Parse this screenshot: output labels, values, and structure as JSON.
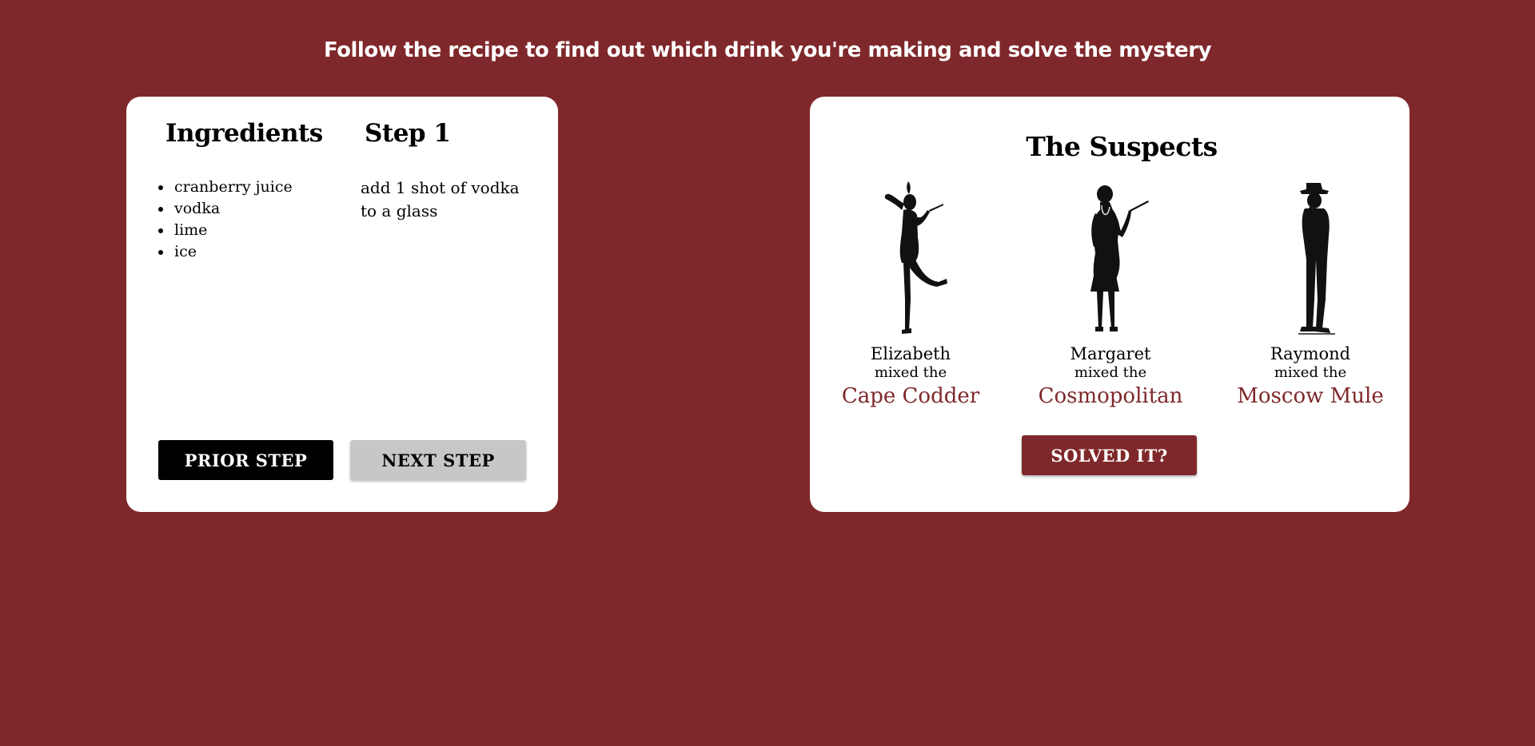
{
  "header": {
    "headline": "Follow the recipe to find out which drink you're making and solve the mystery"
  },
  "recipe": {
    "ingredients_title": "Ingredients",
    "ingredients": [
      "cranberry juice",
      "vodka",
      "lime",
      "ice"
    ],
    "step_title": "Step 1",
    "step_text": "add 1 shot of vodka to a glass",
    "prior_label": "PRIOR STEP",
    "next_label": "NEXT STEP"
  },
  "suspects": {
    "title": "The Suspects",
    "items": [
      {
        "name": "Elizabeth",
        "mixed": "mixed the",
        "drink": "Cape Codder",
        "icon": "flapper-dancing-silhouette"
      },
      {
        "name": "Margaret",
        "mixed": "mixed the",
        "drink": "Cosmopolitan",
        "icon": "flapper-cigarette-silhouette"
      },
      {
        "name": "Raymond",
        "mixed": "mixed the",
        "drink": "Moscow Mule",
        "icon": "gentleman-fedora-silhouette"
      }
    ],
    "solved_label": "SOLVED IT?"
  },
  "colors": {
    "background": "#7f282b",
    "card": "#ffffff",
    "accent": "#7f282b",
    "next_button": "#c7c7c7"
  }
}
